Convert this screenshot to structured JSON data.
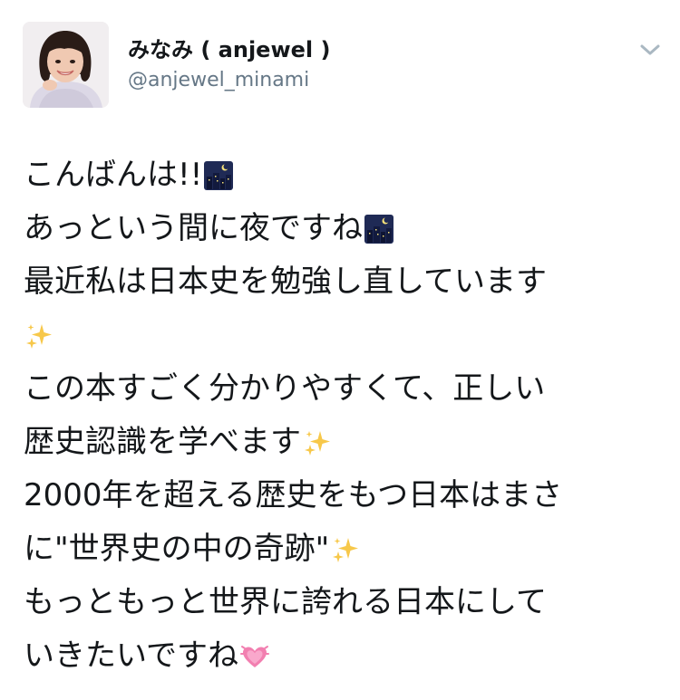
{
  "user": {
    "display_name": "みなみ ( anjewel )",
    "handle": "@anjewel_minami"
  },
  "icons": {
    "avatar": "profile-photo",
    "menu": "chevron-down-icon",
    "night_city": "night-city-emoji-icon",
    "sparkles": "sparkles-emoji-icon",
    "heart": "growing-heart-emoji-icon"
  },
  "colors": {
    "name": "#14171a",
    "handle": "#657786",
    "text": "#14171a",
    "chevron": "#aab8c2"
  },
  "tweet": {
    "lines": [
      "こんばんは!!",
      "あっという間に夜ですね",
      "最近私は日本史を勉強し直しています",
      "",
      "この本すごく分かりやすくて、正しい",
      "歴史認識を学べます",
      "2000年を超える歴史をもつ日本はまさ",
      "に\"世界史の中の奇跡\"",
      "もっともっと世界に誇れる日本にして",
      "いきたいですね"
    ]
  }
}
